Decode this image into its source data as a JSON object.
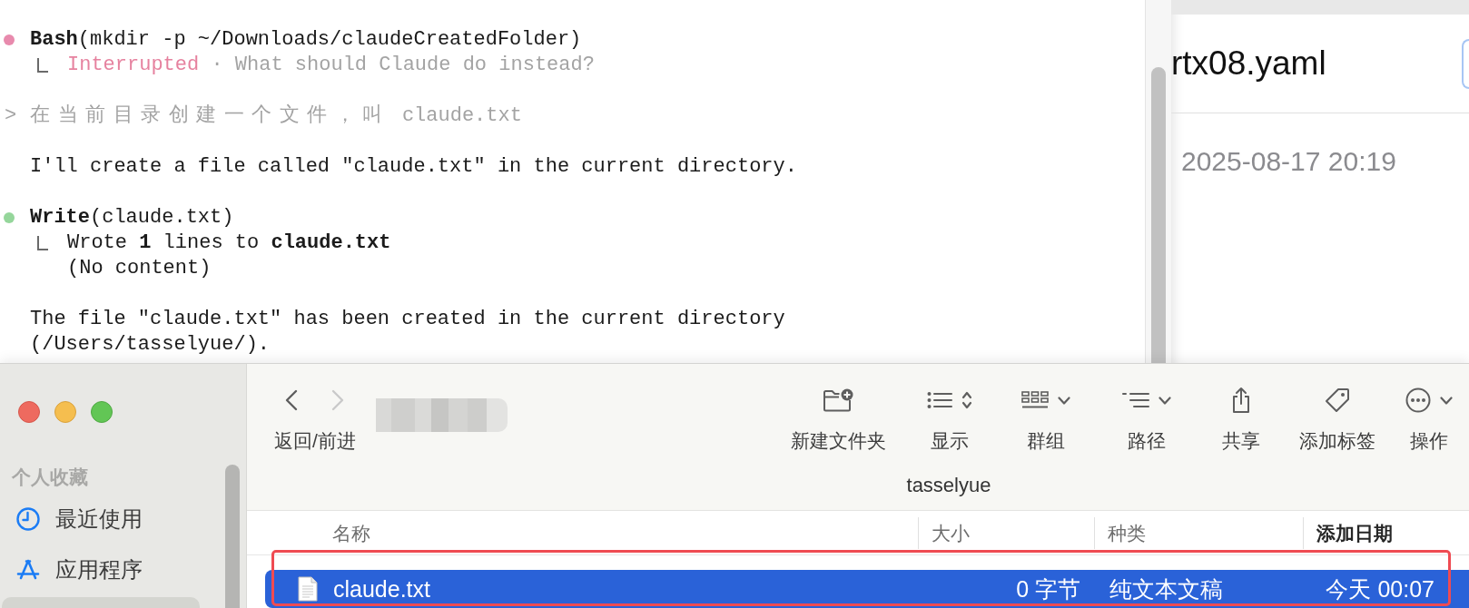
{
  "terminal": {
    "entries": [
      {
        "kind": "tool_call",
        "color": "#e88aad",
        "call": "**Bash**(mkdir -p ~/Downloads/claudeCreatedFolder)",
        "result": [
          {
            "kind": "status",
            "status": "Interrupted",
            "message": "· What should Claude do instead?"
          }
        ]
      },
      {
        "kind": "prompt",
        "marker": ">",
        "text": "在当前目录创建一个文件，叫 claude.txt"
      },
      {
        "kind": "message",
        "text": "I'll create a file called \"claude.txt\" in the current directory."
      },
      {
        "kind": "tool_call",
        "color": "#95d69b",
        "call": "**Write**(claude.txt)",
        "result": [
          {
            "kind": "output",
            "text": "Wrote **1** lines to **claude.txt**"
          },
          {
            "kind": "output",
            "text": "(No content)"
          }
        ]
      },
      {
        "kind": "message",
        "text": "The file \"claude.txt\" has been created in the current directory (/Users/tasselyue/)."
      }
    ]
  },
  "preview": {
    "title": "rtx08.yaml",
    "date": "2025-08-17 20:19"
  },
  "finder": {
    "sidebar": {
      "section_title": "个人收藏",
      "items": [
        {
          "kind": "recents",
          "label": "最近使用",
          "selected": false
        },
        {
          "kind": "applications",
          "label": "应用程序",
          "selected": false
        },
        {
          "selected": true
        }
      ]
    },
    "nav_buttons": [
      {
        "kind": "back",
        "disabled": false
      },
      {
        "kind": "forward",
        "disabled": true
      }
    ],
    "nav_label": "返回/前进",
    "toolbar": [
      {
        "kind": "new_folder",
        "label": "新建文件夹"
      },
      {
        "kind": "view",
        "label": "显示"
      },
      {
        "kind": "group",
        "label": "群组"
      },
      {
        "kind": "path",
        "label": "路径"
      },
      {
        "kind": "share",
        "label": "共享"
      },
      {
        "kind": "tag",
        "label": "添加标签"
      },
      {
        "kind": "action",
        "label": "操作"
      }
    ],
    "title": "tasselyue",
    "columns": [
      {
        "label": "名称",
        "sorted": false
      },
      {
        "label": "大小",
        "sorted": false
      },
      {
        "label": "种类",
        "sorted": false
      },
      {
        "label": "添加日期",
        "sorted": true
      }
    ],
    "rows": [
      {
        "name": "claude.txt",
        "size": "0 字节",
        "file_kind": "纯文本文稿",
        "date_added": "今天 00:07",
        "selected": true
      }
    ]
  }
}
